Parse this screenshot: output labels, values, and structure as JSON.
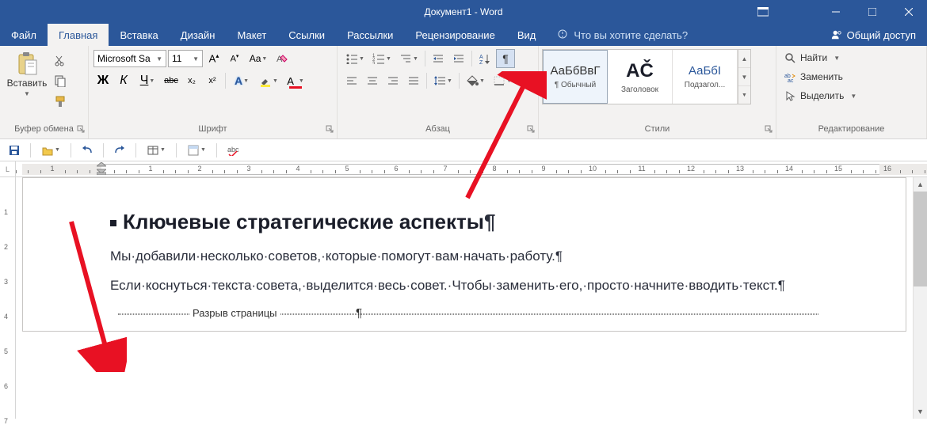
{
  "titlebar": {
    "title": "Документ1 - Word"
  },
  "tabs": {
    "file": "Файл",
    "home": "Главная",
    "insert": "Вставка",
    "design": "Дизайн",
    "layout": "Макет",
    "references": "Ссылки",
    "mailings": "Рассылки",
    "review": "Рецензирование",
    "view": "Вид",
    "tellme": "Что вы хотите сделать?",
    "share": "Общий доступ"
  },
  "clipboard": {
    "paste": "Вставить",
    "title": "Буфер обмена"
  },
  "font": {
    "name": "Microsoft Sa",
    "size": "11",
    "title": "Шрифт",
    "bold": "Ж",
    "italic": "К",
    "underline": "Ч",
    "strike": "abc",
    "sub": "x₂",
    "sup": "x²"
  },
  "paragraph": {
    "title": "Абзац"
  },
  "styles": {
    "title": "Стили",
    "items": [
      {
        "preview": "АаБбВвГ",
        "label": "¶ Обычный"
      },
      {
        "preview": "АČ",
        "label": "Заголовок"
      },
      {
        "preview": "АаБбI",
        "label": "Подзагол..."
      }
    ]
  },
  "editing": {
    "find": "Найти",
    "replace": "Заменить",
    "select": "Выделить",
    "title": "Редактирование"
  },
  "doc": {
    "heading": "Ключевые стратегические аспекты",
    "p1": "Мы·добавили·несколько·советов,·которые·помогут·вам·начать·работу.",
    "p2": "Если·коснуться·текста·совета,·выделится·весь·совет.·Чтобы·заменить·его,·просто·начните·вводить·текст.",
    "pagebreak": "Разрыв страницы",
    "pilcrow": "¶"
  },
  "ruler": {
    "corner": "L"
  }
}
